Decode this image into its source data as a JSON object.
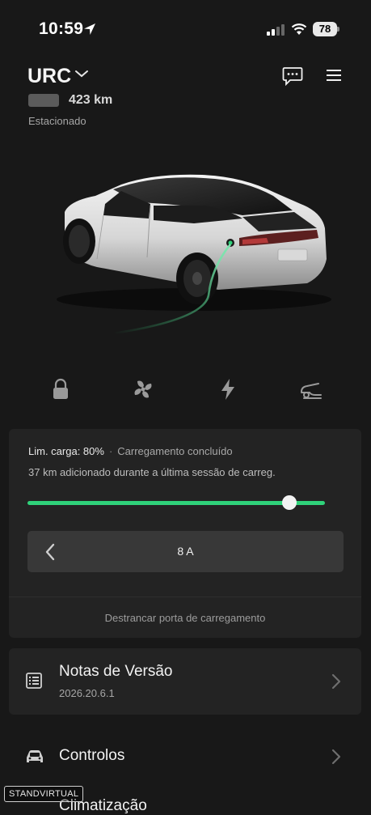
{
  "status_bar": {
    "time": "10:59",
    "battery_percent": "78",
    "icons": [
      "location-arrow-icon",
      "cellular-signal-icon",
      "wifi-icon",
      "battery-icon"
    ]
  },
  "header": {
    "car_name": "URC",
    "range": "423 km",
    "state": "Estacionado"
  },
  "quick_controls": [
    "lock-icon",
    "fan-icon",
    "lightning-icon",
    "trunk-icon"
  ],
  "charging": {
    "limit_label": "Lim. carga: 80%",
    "separator": "·",
    "status": "Carregamento concluído",
    "session_text": "37 km adicionado durante a última sessão de carreg.",
    "limit_fraction": 0.8,
    "current": "8 A",
    "unlock_port_label": "Destrancar porta de carregamento",
    "accent_color": "#2fd27a"
  },
  "release_notes": {
    "title": "Notas de Versão",
    "version": "2026.20.6.1"
  },
  "menu": {
    "controls_label": "Controlos",
    "climate_label": "Climatização"
  },
  "watermark": "STANDVIRTUAL"
}
